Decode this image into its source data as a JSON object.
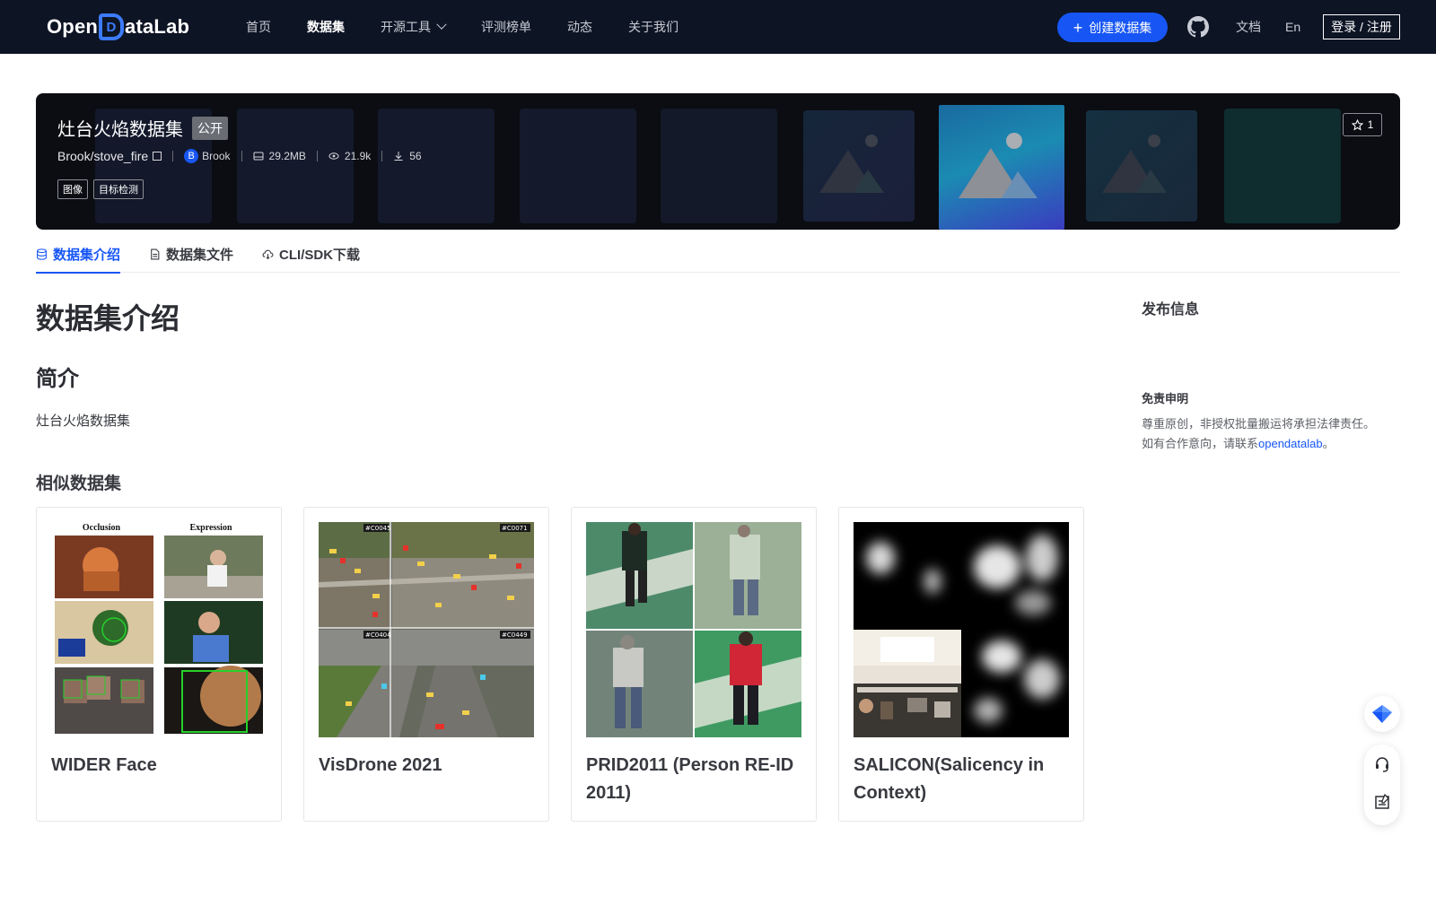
{
  "nav": {
    "logo_text_before": "Open",
    "logo_text_d": "D",
    "logo_text_after": "ataLab",
    "links": [
      {
        "label": "首页",
        "active": false
      },
      {
        "label": "数据集",
        "active": true
      },
      {
        "label": "开源工具",
        "active": false,
        "dropdown": true
      },
      {
        "label": "评测榜单",
        "active": false
      },
      {
        "label": "动态",
        "active": false
      },
      {
        "label": "关于我们",
        "active": false
      }
    ],
    "create_label": "创建数据集",
    "docs_label": "文档",
    "lang_label": "En",
    "login_label": "登录 / 注册",
    "icons": {
      "create": "plus-icon",
      "github": "github-icon",
      "dropdown": "chevron-down-icon"
    }
  },
  "banner": {
    "title": "灶台火焰数据集",
    "visibility": "公开",
    "path": "Brook/stove_fire",
    "author_initial": "B",
    "author": "Brook",
    "size": "29.2MB",
    "views": "21.9k",
    "downloads": "56",
    "tags": [
      "图像",
      "目标检测"
    ],
    "star_count": "1"
  },
  "tabs": [
    {
      "label": "数据集介绍",
      "icon": "database-icon",
      "active": true
    },
    {
      "label": "数据集文件",
      "icon": "file-icon",
      "active": false
    },
    {
      "label": "CLI/SDK下载",
      "icon": "cloud-download-icon",
      "active": false
    }
  ],
  "main": {
    "title": "数据集介绍",
    "intro_heading": "简介",
    "intro_text": "灶台火焰数据集",
    "similar_heading": "相似数据集",
    "similar": [
      {
        "name": "WIDER Face"
      },
      {
        "name": "VisDrone 2021"
      },
      {
        "name": "PRID2011 (Person RE-ID 2011)"
      },
      {
        "name": "SALICON(Salicency in Context)"
      }
    ],
    "wider_labels": {
      "left": "Occlusion",
      "right": "Expression"
    },
    "visdrone_labels": [
      "#C0045",
      "#C0071",
      "#C0404",
      "#C0449"
    ]
  },
  "sidebar": {
    "pub_info": "发布信息",
    "disclaimer_title": "免责申明",
    "disclaimer_line1": "尊重原创，非授权批量搬运将承担法律责任。",
    "disclaimer_line2_prefix": "如有合作意向，请联系",
    "disclaimer_link": "opendatalab",
    "disclaimer_line2_suffix": "。"
  },
  "colors": {
    "nav_bg": "#0d1424",
    "accent": "#1756f5",
    "banner_bg": "#0b0d12"
  }
}
